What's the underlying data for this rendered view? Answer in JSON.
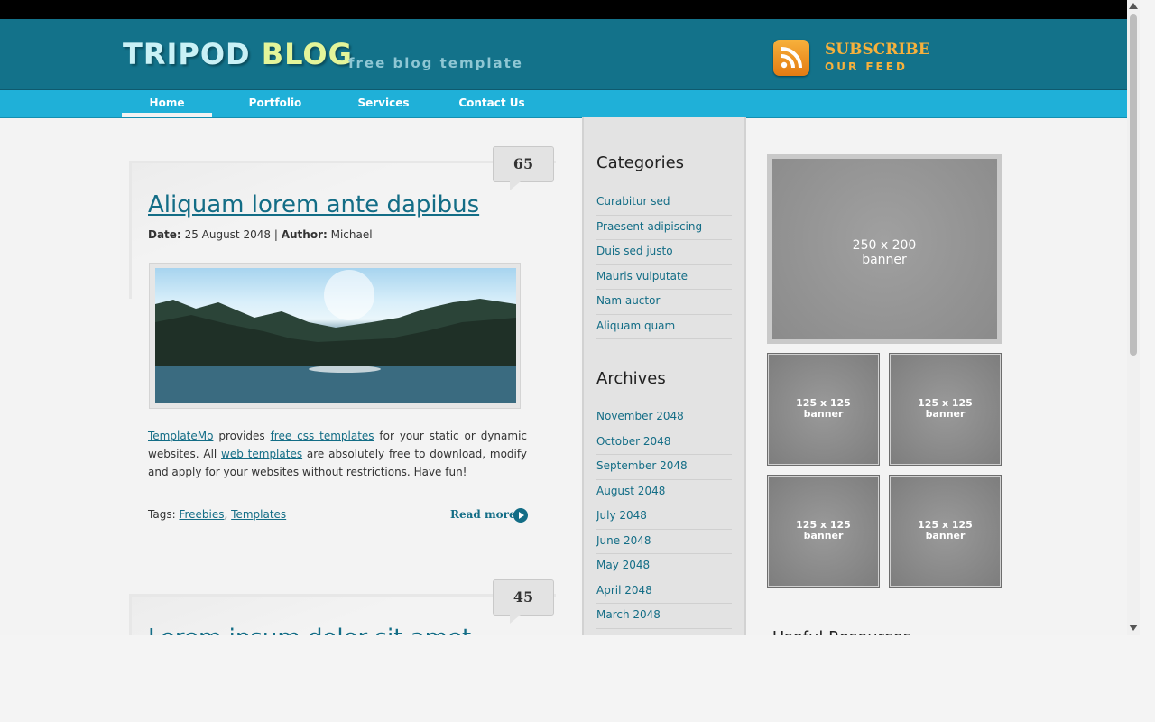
{
  "header": {
    "logo_part1": "TRIPOD",
    "logo_part2": "BLOG",
    "tagline": "free blog template",
    "subscribe_line1": "SUBSCRIBE",
    "subscribe_line2": "OUR FEED"
  },
  "nav": {
    "items": [
      {
        "label": "Home",
        "active": true
      },
      {
        "label": "Portfolio"
      },
      {
        "label": "Services"
      },
      {
        "label": "Contact Us"
      }
    ]
  },
  "posts": [
    {
      "count": "65",
      "title": "Aliquam lorem ante dapibus",
      "date_label": "Date:",
      "date": "25 August 2048",
      "separator": "|",
      "author_label": "Author:",
      "author": "Michael",
      "text_parts": {
        "link1": "TemplateMo",
        "t1": " provides ",
        "link2": "free css templates",
        "t2": " for your static or dynamic websites. All ",
        "link3": "web templates",
        "t3": " are absolutely free to download, modify and apply for your websites without restrictions. Have fun!"
      },
      "tags_label": "Tags:",
      "tag1": "Freebies",
      "tag_sep": ",",
      "tag2": "Templates",
      "read_more": "Read more"
    },
    {
      "count": "45",
      "title": "Lorem ipsum dolor sit amet"
    }
  ],
  "sidebar": {
    "categories_title": "Categories",
    "categories": [
      "Curabitur sed",
      "Praesent adipiscing",
      "Duis sed justo",
      "Mauris vulputate",
      "Nam auctor",
      "Aliquam quam"
    ],
    "archives_title": "Archives",
    "archives": [
      "November 2048",
      "October 2048",
      "September 2048",
      "August 2048",
      "July 2048",
      "June 2048",
      "May 2048",
      "April 2048",
      "March 2048"
    ]
  },
  "banners": {
    "big": {
      "line1": "250 x 200",
      "line2": "banner"
    },
    "small": {
      "line1": "125 x 125",
      "line2": "banner"
    },
    "useful_title": "Useful Resources"
  }
}
